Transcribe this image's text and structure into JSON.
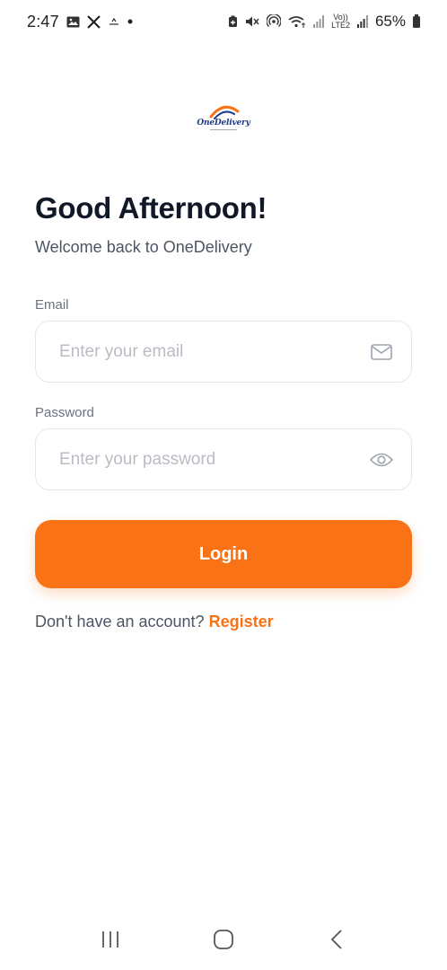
{
  "status_bar": {
    "time": "2:47",
    "battery_percent": "65%",
    "volte_label_top": "Vo))",
    "volte_label_bottom": "LTE2"
  },
  "logo": {
    "brand_text": "OneDelivery",
    "brand_color": "#1e3a8a",
    "accent_color": "#f97316"
  },
  "greeting": {
    "title": "Good Afternoon!",
    "subtitle": "Welcome back to OneDelivery"
  },
  "email_field": {
    "label": "Email",
    "placeholder": "Enter your email",
    "value": "",
    "icon": "mail-icon"
  },
  "password_field": {
    "label": "Password",
    "placeholder": "Enter your password",
    "value": "",
    "icon": "eye-icon"
  },
  "login_button": {
    "label": "Login",
    "color": "#f97316"
  },
  "register": {
    "prompt": "Don't have an account?",
    "link": "Register"
  },
  "nav_bar": {
    "recents_icon": "recents-icon",
    "home_icon": "home-icon",
    "back_icon": "back-icon"
  }
}
